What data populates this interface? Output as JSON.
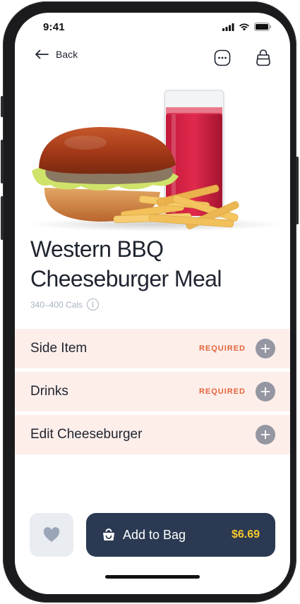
{
  "status": {
    "time": "9:41"
  },
  "nav": {
    "back_label": "Back",
    "more_icon": "more-icon",
    "bag_icon": "shopping-bag-icon"
  },
  "product": {
    "title": "Western BBQ Cheeseburger Meal",
    "calories": "340–400 Cals",
    "info_icon": "i"
  },
  "options": [
    {
      "label": "Side Item",
      "badge": "REQUIRED"
    },
    {
      "label": "Drinks",
      "badge": "REQUIRED"
    },
    {
      "label": "Edit Cheeseburger",
      "badge": ""
    }
  ],
  "footer": {
    "add_label": "Add to Bag",
    "price": "$6.69"
  },
  "colors": {
    "accent_bg": "#fdeeea",
    "required": "#e2643b",
    "primary_button": "#2b3a52",
    "price": "#f7c92a"
  }
}
